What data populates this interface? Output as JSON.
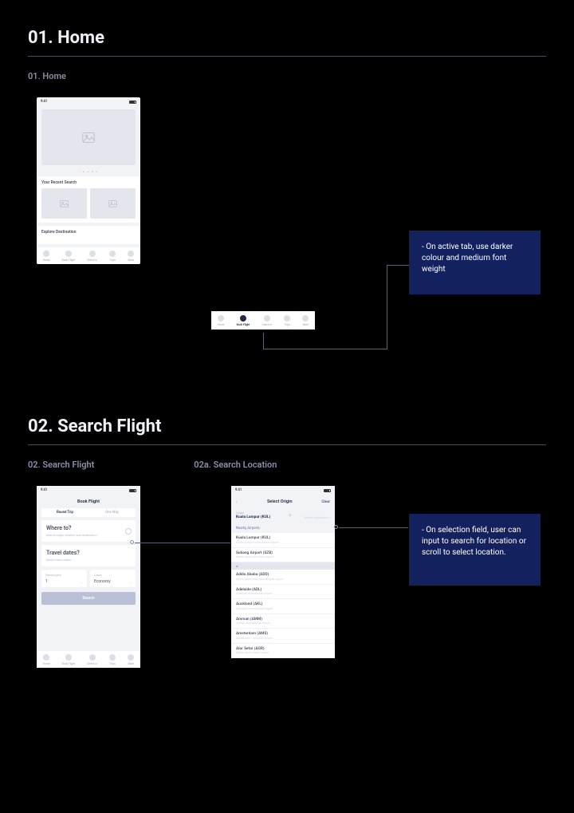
{
  "sections": {
    "s1": {
      "title": "01. Home",
      "sub": "01. Home"
    },
    "s2": {
      "title": "02. Search Flight",
      "sub_a": "02. Search Flight",
      "sub_b": "02a. Search Location"
    }
  },
  "statusbar_time": "9:41",
  "home": {
    "recent_title": "Your Recent Search",
    "explore_title": "Explore Destination"
  },
  "tabs": {
    "t0": "Home",
    "t1": "Book Flight",
    "t2": "Check In",
    "t3": "Trips",
    "t4": "More"
  },
  "notes": {
    "n1": "- On active tab, use darker colour and medium font weight",
    "n2": "- On selection field, user can input to search for location or scroll to select location."
  },
  "book": {
    "header": "Book Flight",
    "seg_round": "Round Trip",
    "seg_oneway": "One Way",
    "where_big": "Where to?",
    "where_small": "Search origin location and destination",
    "dates_big": "Travel dates?",
    "dates_small": "Select travel dates",
    "passengers_label": "Passengers",
    "passengers_value": "1",
    "cabin_label": "Cabin",
    "cabin_value": "Economy",
    "search_btn": "Search"
  },
  "origin": {
    "title": "Select Origin",
    "clear": "Clear",
    "origin_label": "Origin",
    "origin_value": "Kuala Lumpur (KUL)",
    "swap_icon": "⇅",
    "dest_placeholder": "Select Destination",
    "nearby_header": "Nearby Airports",
    "alpha_A": "A",
    "items": {
      "i0": {
        "t": "Kuala Lumpur (KUL)",
        "s": "Kuala Lumpur International Airport"
      },
      "i1": {
        "t": "Subang Airport (SZB)",
        "s": "Sultan Abdul Aziz Shah Airport"
      },
      "i2": {
        "t": "Addis Ababa (ADD)",
        "s": "Addis Ababa Bole International Airport"
      },
      "i3": {
        "t": "Adelaide (ADL)",
        "s": "Adelaide International Airport"
      },
      "i4": {
        "t": "Auckland (AKL)",
        "s": "Auckland International Airport"
      },
      "i5": {
        "t": "Amman (AMM)",
        "s": "Jordan International Airport"
      },
      "i6": {
        "t": "Amsterdam (AMS)",
        "s": "Amsterdam - Schiphol Airport"
      },
      "i7": {
        "t": "Alor Setar (AOR)",
        "s": "Sultan Abdul Halim Airport"
      }
    }
  }
}
